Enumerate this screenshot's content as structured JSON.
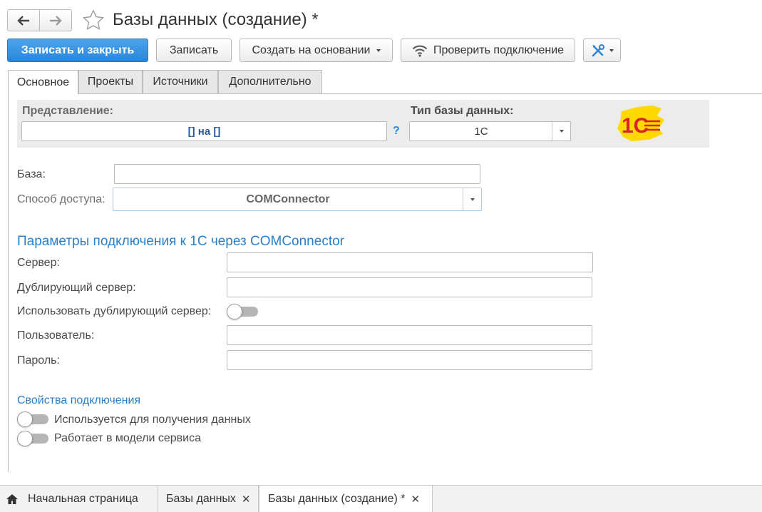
{
  "window": {
    "title": "Базы данных (создание) *"
  },
  "toolbar": {
    "save_close_label": "Записать и закрыть",
    "save_label": "Записать",
    "create_based_label": "Создать на основании",
    "check_connection_label": "Проверить подключение"
  },
  "tabs": [
    {
      "label": "Основное",
      "active": true
    },
    {
      "label": "Проекты",
      "active": false
    },
    {
      "label": "Источники",
      "active": false
    },
    {
      "label": "Дополнительно",
      "active": false
    }
  ],
  "header_panel": {
    "presentation_label": "Представление:",
    "presentation_value": "[] на []",
    "help_symbol": "?",
    "db_type_label": "Тип базы данных:",
    "db_type_value": "1С",
    "logo_text": "1С"
  },
  "form": {
    "base_label": "База:",
    "base_value": "",
    "access_label": "Способ доступа:",
    "access_value": "COMConnector"
  },
  "connection": {
    "title": "Параметры подключения к 1С через COMConnector",
    "server_label": "Сервер:",
    "server_value": "",
    "backup_server_label": "Дублирующий сервер:",
    "backup_server_value": "",
    "use_backup_label": "Использовать дублирующий сервер:",
    "use_backup_on": false,
    "user_label": "Пользователь:",
    "user_value": "",
    "password_label": "Пароль:",
    "password_value": ""
  },
  "properties": {
    "title": "Свойства подключения",
    "items": [
      {
        "label": "Используется для получения данных",
        "on": false
      },
      {
        "label": "Работает в модели сервиса",
        "on": false
      }
    ]
  },
  "bottom_tabs": [
    {
      "label": "Начальная страница"
    },
    {
      "label": "Базы данных"
    },
    {
      "label": "Базы данных (создание) *"
    }
  ],
  "colors": {
    "accent": "#2c86d8",
    "section_title": "#2a7fc9",
    "logo_red": "#d8232a",
    "logo_yellow": "#ffd800"
  }
}
